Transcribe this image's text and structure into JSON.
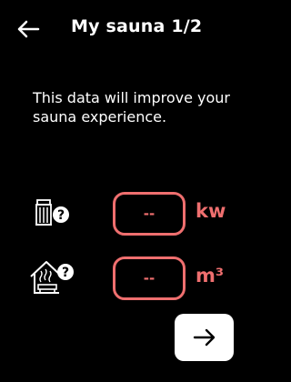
{
  "header": {
    "back_icon": "arrow-left-icon",
    "title": "My sauna 1/2"
  },
  "intro": {
    "text": "This data will improve your sauna experience."
  },
  "heater_power": {
    "icon": "heater-help-icon",
    "value": "--",
    "unit": "kw"
  },
  "sauna_volume": {
    "icon": "sauna-room-help-icon",
    "value": "--",
    "unit": "m³"
  },
  "next_button": {
    "icon": "arrow-right-icon"
  },
  "colors": {
    "background": "#000000",
    "accent": "#ef6f6f",
    "text": "#ffffff"
  }
}
